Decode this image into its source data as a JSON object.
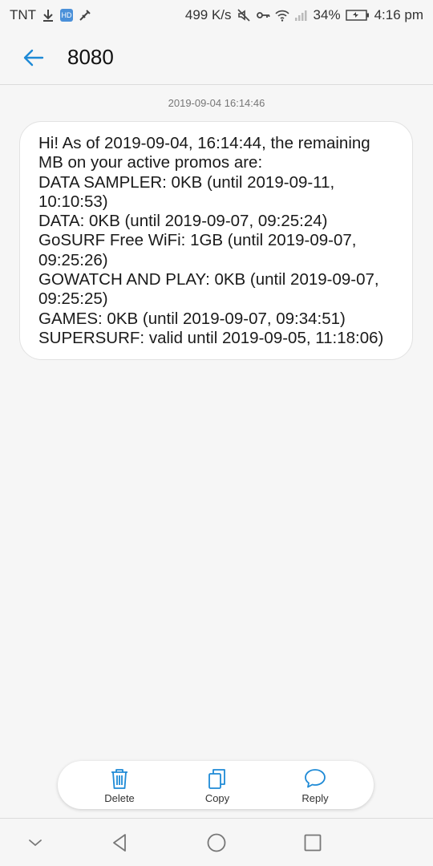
{
  "status_bar": {
    "carrier": "TNT",
    "speed": "499 K/s",
    "battery": "34%",
    "time": "4:16 pm",
    "hd_badge": "HD"
  },
  "header": {
    "title": "8080"
  },
  "conversation": {
    "timestamp": "2019-09-04 16:14:46",
    "message_lines": [
      "Hi! As of 2019-09-04, 16:14:44, the remaining",
      "MB on your active promos are:",
      "DATA SAMPLER: 0KB (until 2019-09-11,",
      "10:10:53)",
      "DATA: 0KB (until 2019-09-07, 09:25:24)",
      "GoSURF Free WiFi: 1GB (until 2019-09-07,",
      "09:25:26)",
      "GOWATCH AND PLAY: 0KB (until 2019-09-07,",
      "09:25:25)",
      "GAMES: 0KB (until 2019-09-07, 09:34:51)",
      "SUPERSURF: valid until 2019-09-05, 11:18:06)"
    ]
  },
  "actions": {
    "delete": "Delete",
    "copy": "Copy",
    "reply": "Reply"
  },
  "colors": {
    "accent": "#1e8ad6",
    "background": "#f6f6f6",
    "bubble": "#ffffff"
  },
  "icons": {
    "back": "arrow-left-icon",
    "delete": "trash-icon",
    "copy": "copy-icon",
    "reply": "speech-bubble-icon"
  }
}
